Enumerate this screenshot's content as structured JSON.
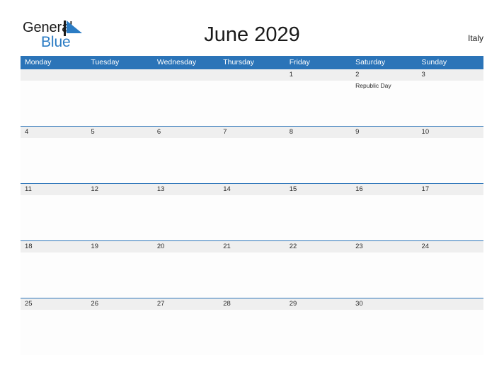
{
  "brand": {
    "name_part1": "General",
    "name_part2": "Blue",
    "triangle_icon": "triangle-icon",
    "accent_color": "#2B7CC4"
  },
  "header": {
    "title": "June 2029",
    "country": "Italy"
  },
  "theme": {
    "header_blue": "#2B74B8",
    "daynum_band": "#efefef",
    "cell_background": "#fdfdfd",
    "text_color": "#2a2a2a"
  },
  "calendar": {
    "weekdays": [
      "Monday",
      "Tuesday",
      "Wednesday",
      "Thursday",
      "Friday",
      "Saturday",
      "Sunday"
    ],
    "weeks": [
      [
        {
          "day": "",
          "event": ""
        },
        {
          "day": "",
          "event": ""
        },
        {
          "day": "",
          "event": ""
        },
        {
          "day": "",
          "event": ""
        },
        {
          "day": "1",
          "event": ""
        },
        {
          "day": "2",
          "event": "Republic Day"
        },
        {
          "day": "3",
          "event": ""
        }
      ],
      [
        {
          "day": "4",
          "event": ""
        },
        {
          "day": "5",
          "event": ""
        },
        {
          "day": "6",
          "event": ""
        },
        {
          "day": "7",
          "event": ""
        },
        {
          "day": "8",
          "event": ""
        },
        {
          "day": "9",
          "event": ""
        },
        {
          "day": "10",
          "event": ""
        }
      ],
      [
        {
          "day": "11",
          "event": ""
        },
        {
          "day": "12",
          "event": ""
        },
        {
          "day": "13",
          "event": ""
        },
        {
          "day": "14",
          "event": ""
        },
        {
          "day": "15",
          "event": ""
        },
        {
          "day": "16",
          "event": ""
        },
        {
          "day": "17",
          "event": ""
        }
      ],
      [
        {
          "day": "18",
          "event": ""
        },
        {
          "day": "19",
          "event": ""
        },
        {
          "day": "20",
          "event": ""
        },
        {
          "day": "21",
          "event": ""
        },
        {
          "day": "22",
          "event": ""
        },
        {
          "day": "23",
          "event": ""
        },
        {
          "day": "24",
          "event": ""
        }
      ],
      [
        {
          "day": "25",
          "event": ""
        },
        {
          "day": "26",
          "event": ""
        },
        {
          "day": "27",
          "event": ""
        },
        {
          "day": "28",
          "event": ""
        },
        {
          "day": "29",
          "event": ""
        },
        {
          "day": "30",
          "event": ""
        },
        {
          "day": "",
          "event": ""
        }
      ]
    ]
  }
}
